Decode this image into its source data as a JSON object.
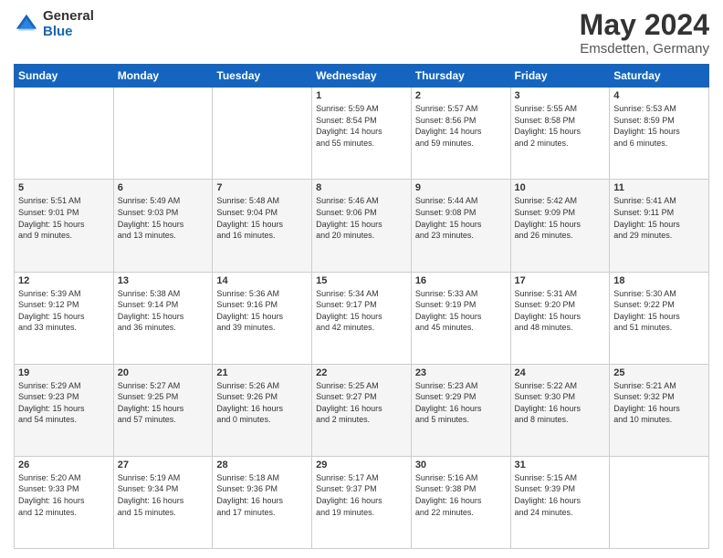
{
  "logo": {
    "general": "General",
    "blue": "Blue"
  },
  "title": {
    "month_year": "May 2024",
    "location": "Emsdetten, Germany"
  },
  "days_of_week": [
    "Sunday",
    "Monday",
    "Tuesday",
    "Wednesday",
    "Thursday",
    "Friday",
    "Saturday"
  ],
  "weeks": [
    [
      {
        "day": "",
        "info": ""
      },
      {
        "day": "",
        "info": ""
      },
      {
        "day": "",
        "info": ""
      },
      {
        "day": "1",
        "info": "Sunrise: 5:59 AM\nSunset: 8:54 PM\nDaylight: 14 hours\nand 55 minutes."
      },
      {
        "day": "2",
        "info": "Sunrise: 5:57 AM\nSunset: 8:56 PM\nDaylight: 14 hours\nand 59 minutes."
      },
      {
        "day": "3",
        "info": "Sunrise: 5:55 AM\nSunset: 8:58 PM\nDaylight: 15 hours\nand 2 minutes."
      },
      {
        "day": "4",
        "info": "Sunrise: 5:53 AM\nSunset: 8:59 PM\nDaylight: 15 hours\nand 6 minutes."
      }
    ],
    [
      {
        "day": "5",
        "info": "Sunrise: 5:51 AM\nSunset: 9:01 PM\nDaylight: 15 hours\nand 9 minutes."
      },
      {
        "day": "6",
        "info": "Sunrise: 5:49 AM\nSunset: 9:03 PM\nDaylight: 15 hours\nand 13 minutes."
      },
      {
        "day": "7",
        "info": "Sunrise: 5:48 AM\nSunset: 9:04 PM\nDaylight: 15 hours\nand 16 minutes."
      },
      {
        "day": "8",
        "info": "Sunrise: 5:46 AM\nSunset: 9:06 PM\nDaylight: 15 hours\nand 20 minutes."
      },
      {
        "day": "9",
        "info": "Sunrise: 5:44 AM\nSunset: 9:08 PM\nDaylight: 15 hours\nand 23 minutes."
      },
      {
        "day": "10",
        "info": "Sunrise: 5:42 AM\nSunset: 9:09 PM\nDaylight: 15 hours\nand 26 minutes."
      },
      {
        "day": "11",
        "info": "Sunrise: 5:41 AM\nSunset: 9:11 PM\nDaylight: 15 hours\nand 29 minutes."
      }
    ],
    [
      {
        "day": "12",
        "info": "Sunrise: 5:39 AM\nSunset: 9:12 PM\nDaylight: 15 hours\nand 33 minutes."
      },
      {
        "day": "13",
        "info": "Sunrise: 5:38 AM\nSunset: 9:14 PM\nDaylight: 15 hours\nand 36 minutes."
      },
      {
        "day": "14",
        "info": "Sunrise: 5:36 AM\nSunset: 9:16 PM\nDaylight: 15 hours\nand 39 minutes."
      },
      {
        "day": "15",
        "info": "Sunrise: 5:34 AM\nSunset: 9:17 PM\nDaylight: 15 hours\nand 42 minutes."
      },
      {
        "day": "16",
        "info": "Sunrise: 5:33 AM\nSunset: 9:19 PM\nDaylight: 15 hours\nand 45 minutes."
      },
      {
        "day": "17",
        "info": "Sunrise: 5:31 AM\nSunset: 9:20 PM\nDaylight: 15 hours\nand 48 minutes."
      },
      {
        "day": "18",
        "info": "Sunrise: 5:30 AM\nSunset: 9:22 PM\nDaylight: 15 hours\nand 51 minutes."
      }
    ],
    [
      {
        "day": "19",
        "info": "Sunrise: 5:29 AM\nSunset: 9:23 PM\nDaylight: 15 hours\nand 54 minutes."
      },
      {
        "day": "20",
        "info": "Sunrise: 5:27 AM\nSunset: 9:25 PM\nDaylight: 15 hours\nand 57 minutes."
      },
      {
        "day": "21",
        "info": "Sunrise: 5:26 AM\nSunset: 9:26 PM\nDaylight: 16 hours\nand 0 minutes."
      },
      {
        "day": "22",
        "info": "Sunrise: 5:25 AM\nSunset: 9:27 PM\nDaylight: 16 hours\nand 2 minutes."
      },
      {
        "day": "23",
        "info": "Sunrise: 5:23 AM\nSunset: 9:29 PM\nDaylight: 16 hours\nand 5 minutes."
      },
      {
        "day": "24",
        "info": "Sunrise: 5:22 AM\nSunset: 9:30 PM\nDaylight: 16 hours\nand 8 minutes."
      },
      {
        "day": "25",
        "info": "Sunrise: 5:21 AM\nSunset: 9:32 PM\nDaylight: 16 hours\nand 10 minutes."
      }
    ],
    [
      {
        "day": "26",
        "info": "Sunrise: 5:20 AM\nSunset: 9:33 PM\nDaylight: 16 hours\nand 12 minutes."
      },
      {
        "day": "27",
        "info": "Sunrise: 5:19 AM\nSunset: 9:34 PM\nDaylight: 16 hours\nand 15 minutes."
      },
      {
        "day": "28",
        "info": "Sunrise: 5:18 AM\nSunset: 9:36 PM\nDaylight: 16 hours\nand 17 minutes."
      },
      {
        "day": "29",
        "info": "Sunrise: 5:17 AM\nSunset: 9:37 PM\nDaylight: 16 hours\nand 19 minutes."
      },
      {
        "day": "30",
        "info": "Sunrise: 5:16 AM\nSunset: 9:38 PM\nDaylight: 16 hours\nand 22 minutes."
      },
      {
        "day": "31",
        "info": "Sunrise: 5:15 AM\nSunset: 9:39 PM\nDaylight: 16 hours\nand 24 minutes."
      },
      {
        "day": "",
        "info": ""
      }
    ]
  ]
}
